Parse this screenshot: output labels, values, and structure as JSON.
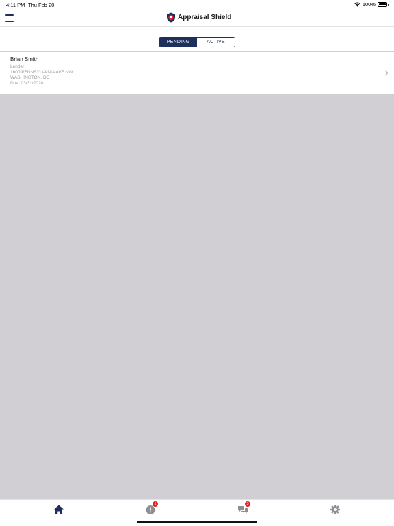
{
  "status_bar": {
    "time": "4:11 PM",
    "date": "Thu Feb 20",
    "battery": "100%"
  },
  "nav": {
    "title": "Appraisal Shield"
  },
  "segments": [
    {
      "label": "PENDING",
      "selected": true
    },
    {
      "label": "ACTIVE",
      "selected": false
    }
  ],
  "list": {
    "items": [
      {
        "name": "Brian Smith",
        "role": "Lender",
        "street": "1600 PENNSYLVANIA AVE NW",
        "city": "WASHINGTON, DC",
        "due": "Due: 03/31/2020"
      }
    ]
  },
  "tab_bar": {
    "tabs": [
      {
        "icon": "home-icon",
        "selected": true
      },
      {
        "icon": "alert-icon",
        "badge": "1"
      },
      {
        "icon": "messages-icon",
        "badge": "3"
      },
      {
        "icon": "gear-icon"
      }
    ]
  },
  "colors": {
    "navy": "#1e2f5c",
    "badge_red": "#e02020",
    "background": "#d1cfd3"
  }
}
